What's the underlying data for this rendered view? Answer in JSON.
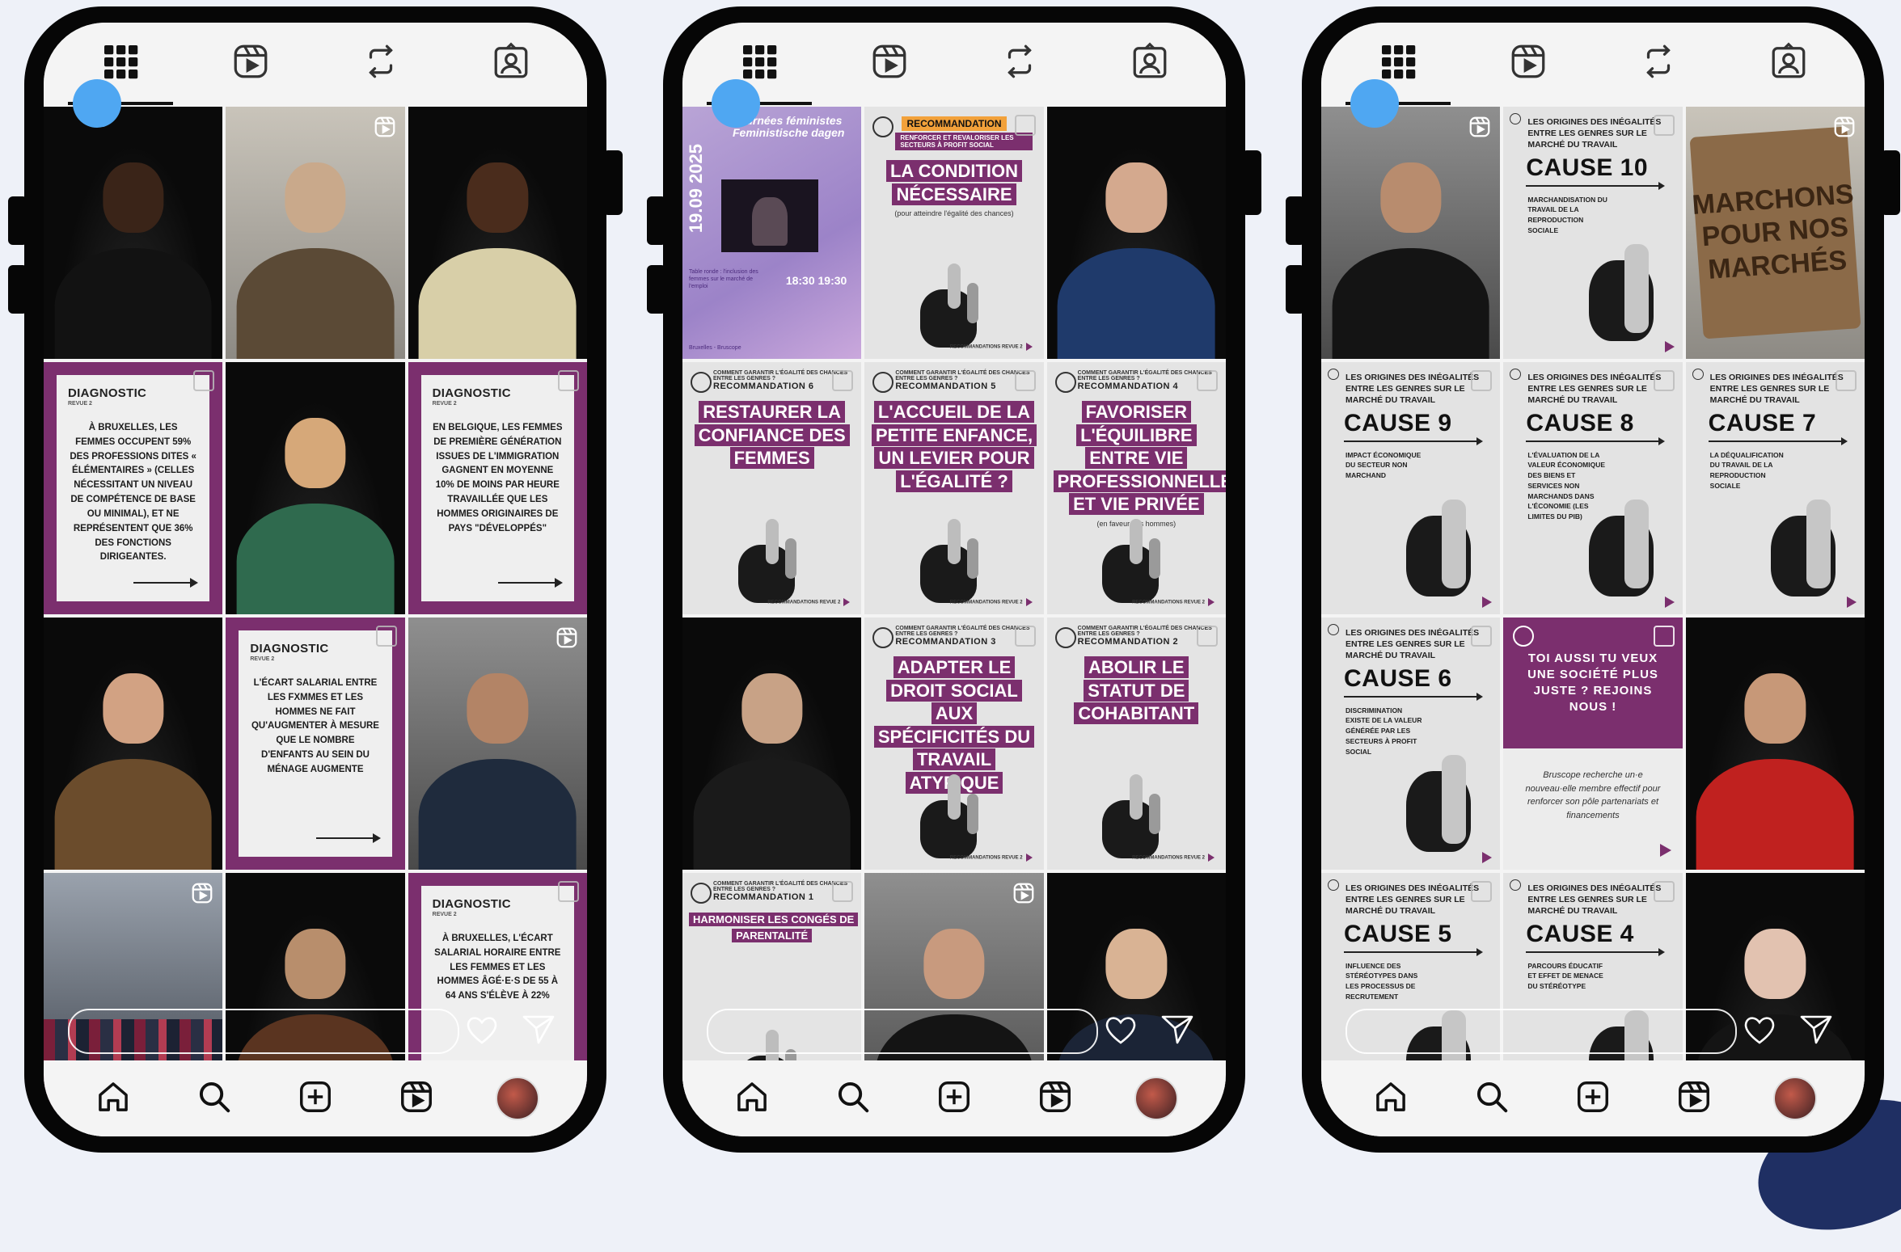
{
  "phones": [
    {
      "tiles": [
        {
          "kind": "photo",
          "head": "#3a2418",
          "body": "#121212"
        },
        {
          "kind": "photo",
          "variant": "light",
          "head": "#c9a98b",
          "body": "#5b4a36",
          "reel": true
        },
        {
          "kind": "photo",
          "head": "#4a2c1c",
          "body": "#d8cfa8"
        },
        {
          "kind": "diag",
          "label": "DIAGNOSTIC",
          "sub": "REVUE 2",
          "text": "À Bruxelles, les femmes occupent 59% des professions dites « élémentaires » (celles nécessitant un niveau de compétence de base ou minimal), et ne représentent que 36% des fonctions dirigeantes."
        },
        {
          "kind": "photo",
          "head": "#d6a879",
          "body": "#2f6a4e"
        },
        {
          "kind": "diag",
          "label": "DIAGNOSTIC",
          "sub": "REVUE 2",
          "text": "En Belgique, les femmes de première génération issues de l'immigration gagnent en moyenne 10% de moins par heure travaillée que les hommes originaires de pays \"développés\""
        },
        {
          "kind": "photo",
          "head": "#d2a283",
          "body": "#6b4c2c"
        },
        {
          "kind": "diag",
          "label": "DIAGNOSTIC",
          "sub": "REVUE 2",
          "text": "L'écart salarial entre les fxmmes et les hommes ne fait qu'augmenter à mesure que le nombre d'enfants au sein du ménage augmente"
        },
        {
          "kind": "photo",
          "variant": "grey",
          "head": "#b38466",
          "body": "#1f2b3d",
          "reel": true
        },
        {
          "kind": "photo",
          "variant": "street",
          "crowd": true,
          "reel": true
        },
        {
          "kind": "photo",
          "head": "#b88e6c",
          "body": "#5a3420"
        },
        {
          "kind": "diag",
          "label": "DIAGNOSTIC",
          "sub": "REVUE 2",
          "text": "À Bruxelles, l'écart salarial horaire entre les femmes et les hommes âgé·e·s de 55 à 64 ans s'élève à 22%"
        }
      ]
    },
    {
      "tiles": [
        {
          "kind": "event",
          "title": "Journées féministes Feministische dagen",
          "date": "19.09 2025",
          "time": "18:30 19:30",
          "lines": "Table ronde : l'inclusion des femmes sur le marché de l'emploi",
          "foot": "Bruxelles - Bruscope"
        },
        {
          "kind": "rec",
          "banner": "RECOMMANDATION",
          "band": "RENFORCER ET REVALORISER LES SECTEURS À PROFIT SOCIAL",
          "title": "LA CONDITION NÉCESSAIRE",
          "note": "(pour atteindre l'égalité des chances)",
          "foot": "RECOMMANDATIONS REVUE 2"
        },
        {
          "kind": "photo",
          "head": "#d4a98e",
          "body": "#1f3a6b"
        },
        {
          "kind": "rec",
          "head": "COMMENT GARANTIR L'ÉGALITÉ DES CHANCES ENTRE LES GENRES ?",
          "num": "RECOMMANDATION 6",
          "title": "RESTAURER LA CONFIANCE DES FEMMES",
          "foot": "RECOMMANDATIONS REVUE 2"
        },
        {
          "kind": "rec",
          "head": "COMMENT GARANTIR L'ÉGALITÉ DES CHANCES ENTRE LES GENRES ?",
          "num": "RECOMMANDATION 5",
          "title": "L'ACCUEIL DE LA PETITE ENFANCE, UN LEVIER POUR L'ÉGALITÉ ?",
          "foot": "RECOMMANDATIONS REVUE 2"
        },
        {
          "kind": "rec",
          "head": "COMMENT GARANTIR L'ÉGALITÉ DES CHANCES ENTRE LES GENRES ?",
          "num": "RECOMMANDATION 4",
          "title": "FAVORISER L'ÉQUILIBRE ENTRE VIE PROFESSIONNELLE ET VIE PRIVÉE",
          "note": "(en faveur des hommes)",
          "foot": "RECOMMANDATIONS REVUE 2"
        },
        {
          "kind": "photo",
          "head": "#c8a286",
          "body": "#1a1a1a"
        },
        {
          "kind": "rec",
          "head": "COMMENT GARANTIR L'ÉGALITÉ DES CHANCES ENTRE LES GENRES ?",
          "num": "RECOMMANDATION 3",
          "title": "ADAPTER LE DROIT SOCIAL AUX SPÉCIFICITÉS DU TRAVAIL ATYPIQUE",
          "foot": "RECOMMANDATIONS REVUE 2"
        },
        {
          "kind": "rec",
          "head": "COMMENT GARANTIR L'ÉGALITÉ DES CHANCES ENTRE LES GENRES ?",
          "num": "RECOMMANDATION 2",
          "title": "ABOLIR LE STATUT DE COHABITANT",
          "foot": "RECOMMANDATIONS REVUE 2"
        },
        {
          "kind": "rec",
          "head": "COMMENT GARANTIR L'ÉGALITÉ DES CHANCES ENTRE LES GENRES ?",
          "num": "RECOMMANDATION 1",
          "title": "HARMONISER LES CONGÉS DE PARENTALITÉ",
          "small": true,
          "foot": ""
        },
        {
          "kind": "photo",
          "variant": "grey",
          "head": "#c89a7e",
          "body": "#141414",
          "reel": true
        },
        {
          "kind": "photo",
          "head": "#d9b394",
          "body": "#1b2436"
        }
      ]
    },
    {
      "tiles": [
        {
          "kind": "photo",
          "variant": "grey",
          "head": "#b88c6e",
          "body": "#141414",
          "reel": true
        },
        {
          "kind": "cause",
          "head": "Les origines des inégalités entre les genres sur le marché du travail",
          "num": "CAUSE 10",
          "desc": "Marchandisation du travail de la reproduction sociale"
        },
        {
          "kind": "photo",
          "variant": "light",
          "sign": "MARCHONS POUR NOS MARCHÉS",
          "reel": true
        },
        {
          "kind": "cause",
          "head": "Les origines des inégalités entre les genres sur le marché du travail",
          "num": "CAUSE 9",
          "desc": "Impact économique du secteur non marchand"
        },
        {
          "kind": "cause",
          "head": "Les origines des inégalités entre les genres sur le marché du travail",
          "num": "CAUSE 8",
          "desc": "L'évaluation de la valeur économique des biens et services non marchands dans l'économie (les limites du PIB)"
        },
        {
          "kind": "cause",
          "head": "Les origines des inégalités entre les genres sur le marché du travail",
          "num": "CAUSE 7",
          "desc": "La déqualification du travail de la reproduction sociale"
        },
        {
          "kind": "cause",
          "head": "Les origines des inégalités entre les genres sur le marché du travail",
          "num": "CAUSE 6",
          "desc": "Discrimination existe de la valeur générée par les secteurs à profit social"
        },
        {
          "kind": "join",
          "top": "TOI AUSSI TU VEUX UNE SOCIÉTÉ PLUS JUSTE ? REJOINS NOUS !",
          "text": "Bruscope recherche un·e nouveau·elle membre effectif pour renforcer son pôle partenariats et financements"
        },
        {
          "kind": "photo",
          "head": "#c79878",
          "body": "#c0211f"
        },
        {
          "kind": "cause",
          "head": "Les origines des inégalités entre les genres sur le marché du travail",
          "num": "CAUSE 5",
          "desc": "Influence des stéréotypes dans les processus de recrutement"
        },
        {
          "kind": "cause",
          "head": "Les origines des inégalités entre les genres sur le marché du travail",
          "num": "CAUSE 4",
          "desc": "Parcours éducatif et effet de menace du stéréotype"
        },
        {
          "kind": "photo",
          "head": "#e2c2b0",
          "body": "#141414"
        }
      ]
    }
  ],
  "icons": {
    "tabs": [
      "grid-icon",
      "reels-icon",
      "repost-icon",
      "tagged-icon"
    ],
    "nav": [
      "home-icon",
      "search-icon",
      "create-icon",
      "reels-nav-icon",
      "profile-avatar"
    ]
  },
  "colors": {
    "brand_purple": "#7b2f6e",
    "accent_orange": "#f2a13a",
    "dot_blue": "#4fa7f2"
  }
}
